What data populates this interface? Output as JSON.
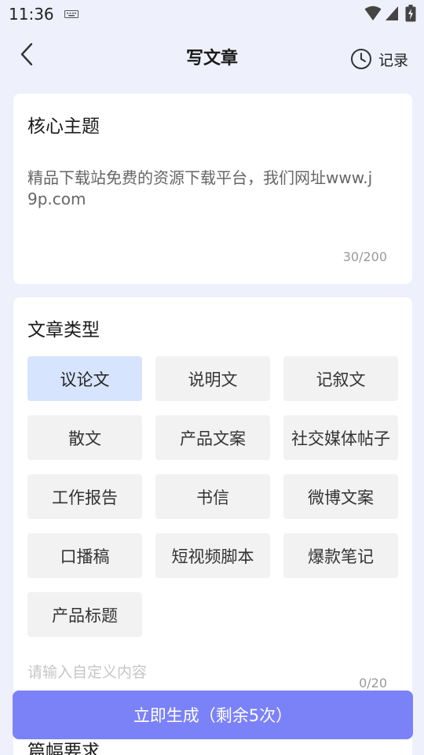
{
  "status_bar": {
    "time": "11:36"
  },
  "header": {
    "title": "写文章",
    "history_label": "记录"
  },
  "topic": {
    "title": "核心主题",
    "text": "精品下载站免费的资源下载平台，我们网址www.j9p.com",
    "count": "30/200"
  },
  "article_type": {
    "title": "文章类型",
    "selected": "议论文",
    "options": [
      "议论文",
      "说明文",
      "记叙文",
      "散文",
      "产品文案",
      "社交媒体帖子",
      "工作报告",
      "书信",
      "微博文案",
      "口播稿",
      "短视频脚本",
      "爆款笔记",
      "产品标题"
    ],
    "custom_placeholder": "请输入自定义内容",
    "custom_count": "0/20"
  },
  "length": {
    "title": "篇幅要求"
  },
  "generate": {
    "label": "立即生成（剩余5次）"
  }
}
